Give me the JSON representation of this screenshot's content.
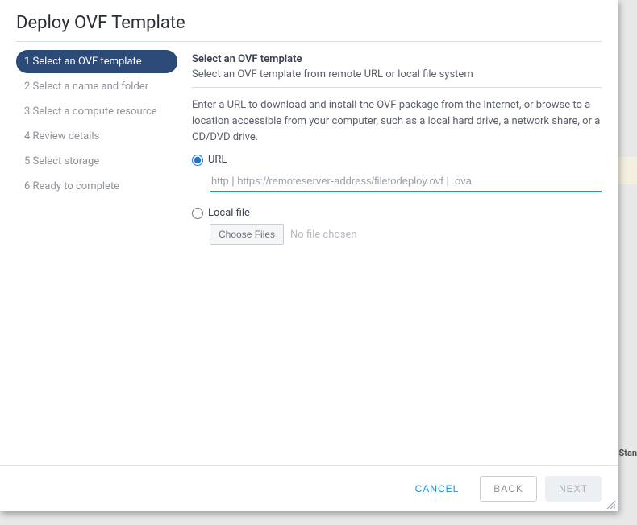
{
  "dialog_title": "Deploy OVF Template",
  "steps": [
    {
      "label": "1 Select an OVF template",
      "active": true
    },
    {
      "label": "2 Select a name and folder",
      "active": false
    },
    {
      "label": "3 Select a compute resource",
      "active": false
    },
    {
      "label": "4 Review details",
      "active": false
    },
    {
      "label": "5 Select storage",
      "active": false
    },
    {
      "label": "6 Ready to complete",
      "active": false
    }
  ],
  "panel": {
    "title": "Select an OVF template",
    "subtitle": "Select an OVF template from remote URL or local file system",
    "description": "Enter a URL to download and install the OVF package from the Internet, or browse to a location accessible from your computer, such as a local hard drive, a network share, or a CD/DVD drive.",
    "url_label": "URL",
    "url_placeholder": "http | https://remoteserver-address/filetodeploy.ovf | .ova",
    "url_value": "",
    "local_label": "Local file",
    "choose_files_label": "Choose Files",
    "no_file_text": "No file chosen",
    "selected_source": "url"
  },
  "footer": {
    "cancel": "CANCEL",
    "back": "BACK",
    "next": "NEXT"
  },
  "background": {
    "tag_text": "Stan"
  }
}
